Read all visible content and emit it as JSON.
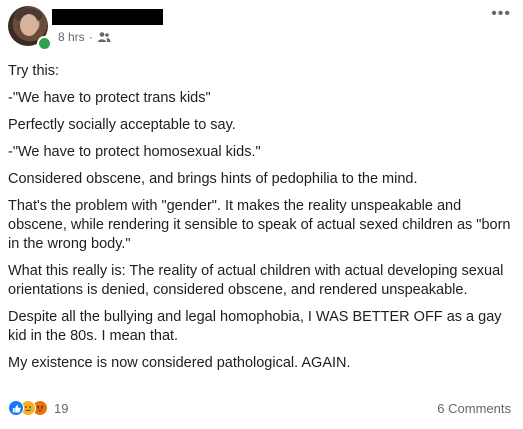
{
  "header": {
    "timestamp": "8 hrs",
    "separator": "·",
    "audience_icon": "friends-icon",
    "more_icon": "more-options-icon",
    "more_glyph": "•••",
    "online_color": "#31a24c"
  },
  "post": {
    "paragraphs": [
      "Try this:",
      "-\"We have to protect trans kids\"",
      "Perfectly socially acceptable to say.",
      "-\"We have to protect homosexual kids.\"",
      "Considered obscene, and brings hints of pedophilia to the mind.",
      "That's the problem with \"gender\". It makes the reality unspeakable and obscene, while rendering it sensible to speak of actual sexed children as \"born in the wrong body.\"",
      "What this really is: The reality of actual children with actual developing sexual orientations is denied, considered obscene, and rendered unspeakable.",
      "Despite all the bullying and legal homophobia, I WAS BETTER OFF as a gay kid in the 80s. I mean that.",
      "My existence is now considered pathological. AGAIN."
    ]
  },
  "footer": {
    "reactions": [
      "like-icon",
      "sad-icon",
      "angry-icon"
    ],
    "reaction_count": "19",
    "comments_label": "6 Comments",
    "like_color": "#1877f2",
    "sad_color": "#f7b125",
    "angry_color": "#e9710f"
  }
}
